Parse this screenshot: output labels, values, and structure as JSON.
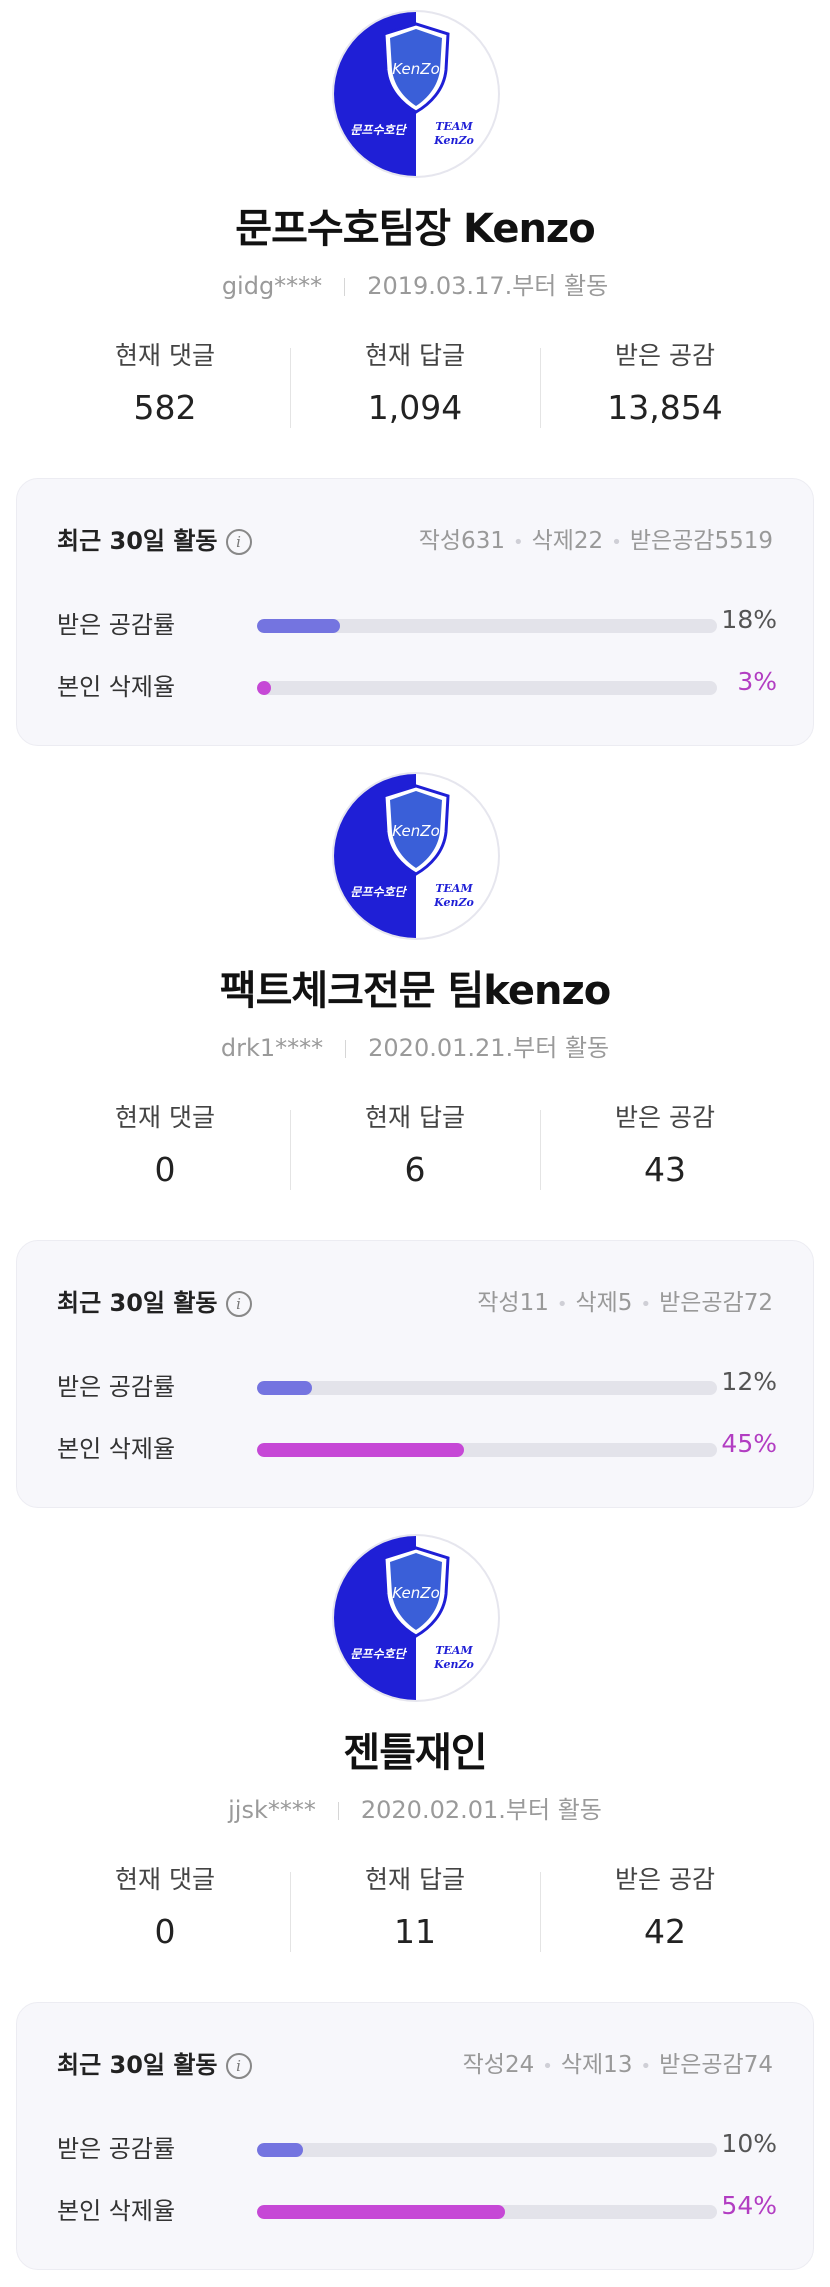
{
  "labels": {
    "current_comments": "현재 댓글",
    "current_replies": "현재 답글",
    "received_likes": "받은 공감",
    "card_title": "최근 30일 활동",
    "like_rate": "받은 공감률",
    "delete_rate": "본인 삭제율"
  },
  "avatar": {
    "shield_text": "KenZo",
    "left_text": "문프수호단",
    "right_text_1": "TEAM",
    "right_text_2": "KenZo",
    "left_color": "#1f1fd6"
  },
  "colors": {
    "like_bar": "#7474e0",
    "delete_bar": "#c648d6",
    "like_value": "#555555",
    "delete_value": "#b23dc2"
  },
  "profiles": [
    {
      "name": "문프수호팀장 Kenzo",
      "user_id": "gidg****",
      "since": "2019.03.17.부터 활동",
      "comments": "582",
      "replies": "1,094",
      "likes": "13,854",
      "written": "작성631",
      "deleted": "삭제22",
      "received": "받은공감5519",
      "like_rate_text": "18%",
      "like_rate": 0.18,
      "delete_rate_text": "3%",
      "delete_rate": 0.03
    },
    {
      "name": "팩트체크전문 팀kenzo",
      "user_id": "drk1****",
      "since": "2020.01.21.부터 활동",
      "comments": "0",
      "replies": "6",
      "likes": "43",
      "written": "작성11",
      "deleted": "삭제5",
      "received": "받은공감72",
      "like_rate_text": "12%",
      "like_rate": 0.12,
      "delete_rate_text": "45%",
      "delete_rate": 0.45
    },
    {
      "name": "젠틀재인",
      "user_id": "jjsk****",
      "since": "2020.02.01.부터 활동",
      "comments": "0",
      "replies": "11",
      "likes": "42",
      "written": "작성24",
      "deleted": "삭제13",
      "received": "받은공감74",
      "like_rate_text": "10%",
      "like_rate": 0.1,
      "delete_rate_text": "54%",
      "delete_rate": 0.54
    }
  ]
}
